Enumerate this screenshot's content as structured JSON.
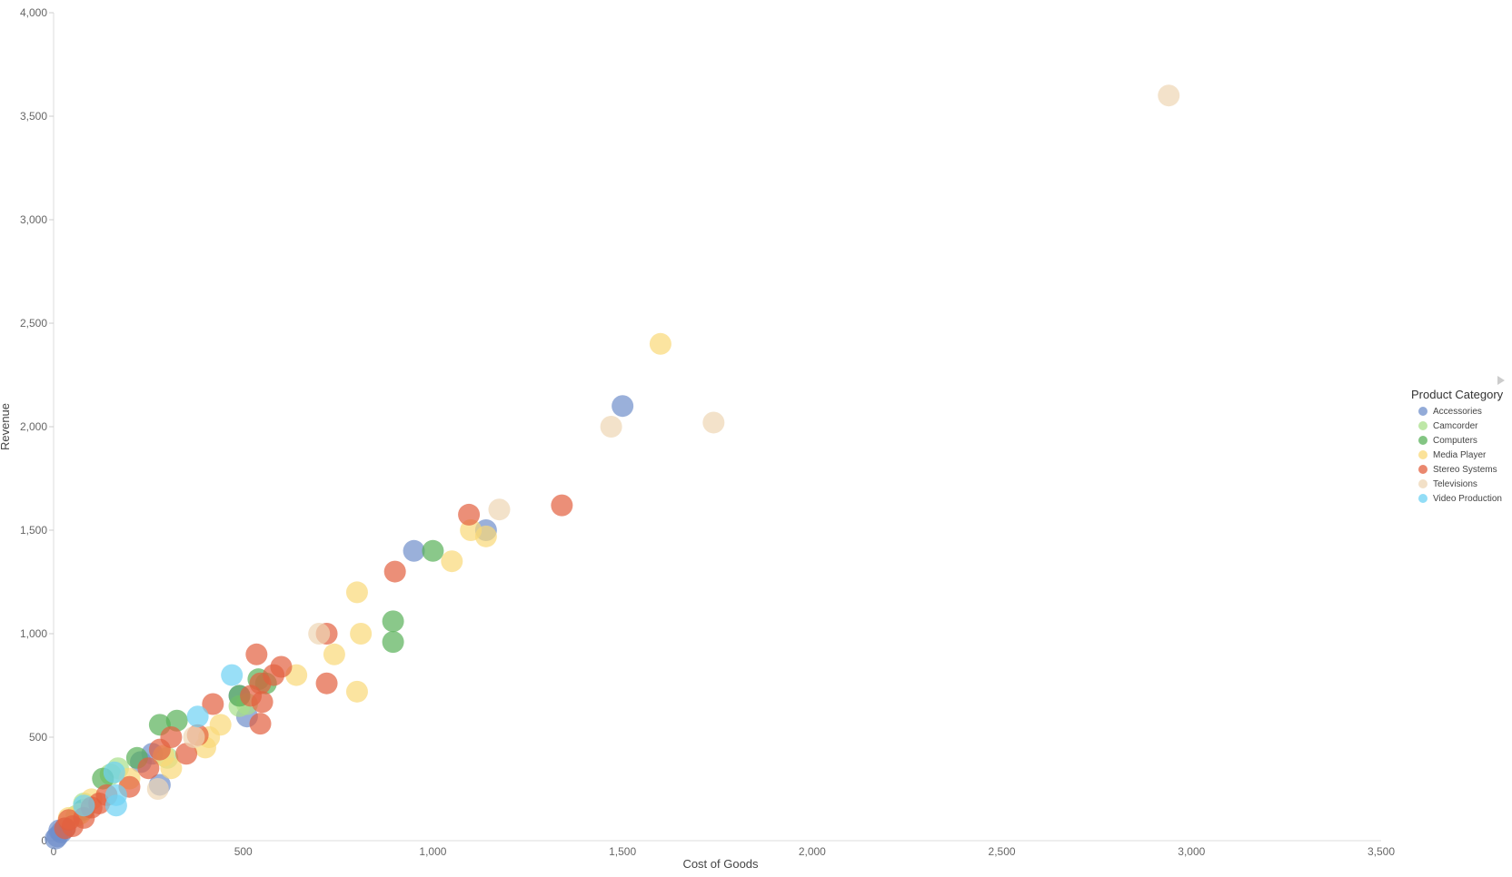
{
  "chart_data": {
    "type": "scatter",
    "title": "",
    "xlabel": "Cost of Goods",
    "ylabel": "Revenue",
    "xlim": [
      0,
      3500
    ],
    "ylim": [
      0,
      4000
    ],
    "x_ticks": [
      "0",
      "500",
      "1,000",
      "1,500",
      "2,000",
      "2,500",
      "3,000",
      "3,500"
    ],
    "x_tick_values": [
      0,
      500,
      1000,
      1500,
      2000,
      2500,
      3000,
      3500
    ],
    "y_ticks": [
      "0",
      "500",
      "1,000",
      "1,500",
      "2,000",
      "2,500",
      "3,000",
      "3,500",
      "4,000"
    ],
    "y_tick_values": [
      0,
      500,
      1000,
      1500,
      2000,
      2500,
      3000,
      3500,
      4000
    ],
    "grid": false,
    "legend": {
      "title": "Product Category",
      "placement": "right",
      "entries": [
        "Accessories",
        "Camcorder",
        "Computers",
        "Media Player",
        "Stereo Systems",
        "Televisions",
        "Video Production"
      ]
    },
    "colors": {
      "Accessories": "#6f8fcb",
      "Camcorder": "#a8df8a",
      "Computers": "#59b159",
      "Media Player": "#f9d877",
      "Stereo Systems": "#e3603f",
      "Televisions": "#eed6b4",
      "Video Production": "#6ed2f3"
    },
    "series": [
      {
        "name": "Accessories",
        "points": [
          [
            1500,
            2100
          ],
          [
            950,
            1400
          ],
          [
            1140,
            1500
          ],
          [
            510,
            600
          ],
          [
            490,
            700
          ],
          [
            280,
            270
          ],
          [
            260,
            420
          ],
          [
            230,
            380
          ],
          [
            10,
            20
          ],
          [
            20,
            40
          ],
          [
            30,
            60
          ],
          [
            15,
            50
          ],
          [
            5,
            10
          ]
        ]
      },
      {
        "name": "Camcorder",
        "points": [
          [
            490,
            650
          ],
          [
            510,
            660
          ],
          [
            170,
            350
          ],
          [
            150,
            320
          ],
          [
            80,
            180
          ],
          [
            60,
            120
          ],
          [
            300,
            400
          ]
        ]
      },
      {
        "name": "Computers",
        "points": [
          [
            1000,
            1400
          ],
          [
            895,
            1060
          ],
          [
            895,
            960
          ],
          [
            540,
            780
          ],
          [
            560,
            760
          ],
          [
            490,
            700
          ],
          [
            280,
            560
          ],
          [
            325,
            580
          ],
          [
            220,
            400
          ],
          [
            130,
            300
          ],
          [
            80,
            150
          ]
        ]
      },
      {
        "name": "Media Player",
        "points": [
          [
            1600,
            2400
          ],
          [
            1100,
            1500
          ],
          [
            1140,
            1470
          ],
          [
            1050,
            1350
          ],
          [
            800,
            1200
          ],
          [
            810,
            1000
          ],
          [
            740,
            900
          ],
          [
            800,
            720
          ],
          [
            640,
            800
          ],
          [
            440,
            560
          ],
          [
            400,
            450
          ],
          [
            410,
            500
          ],
          [
            310,
            350
          ],
          [
            290,
            410
          ],
          [
            200,
            300
          ],
          [
            70,
            130
          ],
          [
            40,
            110
          ],
          [
            100,
            200
          ]
        ]
      },
      {
        "name": "Stereo Systems",
        "points": [
          [
            1340,
            1620
          ],
          [
            1095,
            1575
          ],
          [
            900,
            1300
          ],
          [
            720,
            1000
          ],
          [
            720,
            760
          ],
          [
            535,
            900
          ],
          [
            600,
            840
          ],
          [
            580,
            800
          ],
          [
            545,
            760
          ],
          [
            520,
            700
          ],
          [
            550,
            670
          ],
          [
            545,
            565
          ],
          [
            420,
            660
          ],
          [
            380,
            510
          ],
          [
            350,
            420
          ],
          [
            310,
            500
          ],
          [
            280,
            440
          ],
          [
            250,
            350
          ],
          [
            200,
            260
          ],
          [
            140,
            220
          ],
          [
            120,
            180
          ],
          [
            100,
            160
          ],
          [
            80,
            110
          ],
          [
            50,
            70
          ],
          [
            40,
            100
          ],
          [
            30,
            60
          ]
        ]
      },
      {
        "name": "Televisions",
        "points": [
          [
            2940,
            3600
          ],
          [
            1740,
            2020
          ],
          [
            1470,
            2000
          ],
          [
            1175,
            1600
          ],
          [
            700,
            1000
          ],
          [
            370,
            500
          ],
          [
            275,
            250
          ]
        ]
      },
      {
        "name": "Video Production",
        "points": [
          [
            470,
            800
          ],
          [
            380,
            600
          ],
          [
            160,
            330
          ],
          [
            165,
            220
          ],
          [
            165,
            170
          ],
          [
            80,
            170
          ]
        ]
      }
    ]
  }
}
